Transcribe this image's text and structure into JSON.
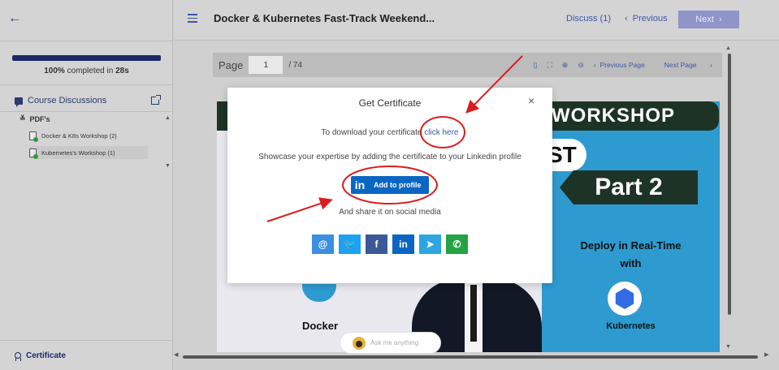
{
  "sidebar": {
    "progress_percent": 100,
    "progress_pct_label": "100%",
    "progress_rest_label": "completed in",
    "progress_time": "28s",
    "discussions_label": "Course Discussions",
    "section_label": "PDF's",
    "items": [
      {
        "label": "Docker & K8s Workshop (2)"
      },
      {
        "label": "Kubernetes's Workshop (1)"
      }
    ],
    "certificate_label": "Certificate"
  },
  "header": {
    "title": "Docker & Kubernetes Fast-Track Weekend...",
    "discuss_label": "Discuss (1)",
    "previous_label": "Previous",
    "next_label": "Next"
  },
  "viewer": {
    "page_label": "Page",
    "page_value": "1",
    "page_total": "/ 74",
    "prev_page_label": "Previous Page",
    "next_page_label": "Next Page"
  },
  "poster": {
    "banner_text": "WORKSHOP",
    "st_text": "ST",
    "part_text": "Part 2",
    "deploy_line1": "Deploy in Real-Time",
    "deploy_line2": "with",
    "docker_text": "Docker",
    "kubernetes_text": "Kubernetes"
  },
  "ask": {
    "placeholder": "Ask me anything"
  },
  "modal": {
    "title": "Get Certificate",
    "close_glyph": "×",
    "download_prefix": "To download your certificate",
    "download_link": "click here",
    "showcase_text": "Showcase your expertise by adding the certificate to your Linkedin profile",
    "linkedin_logo": "in",
    "add_profile_label": "Add to profile",
    "share_text": "And share it on social media",
    "social": [
      {
        "icon": "email-icon",
        "glyph": "@",
        "color": "#3b8ee0"
      },
      {
        "icon": "twitter-icon",
        "glyph": "🐦",
        "color": "#1da1f2"
      },
      {
        "icon": "facebook-icon",
        "glyph": "f",
        "color": "#3b5998"
      },
      {
        "icon": "linkedin-icon",
        "glyph": "in",
        "color": "#0a66c2"
      },
      {
        "icon": "telegram-icon",
        "glyph": "➤",
        "color": "#2ca5e0"
      },
      {
        "icon": "whatsapp-icon",
        "glyph": "✆",
        "color": "#25a244"
      }
    ]
  },
  "colors": {
    "brand": "#1b2a66",
    "accent": "#3e58a8",
    "annotation": "#d81e1e"
  }
}
